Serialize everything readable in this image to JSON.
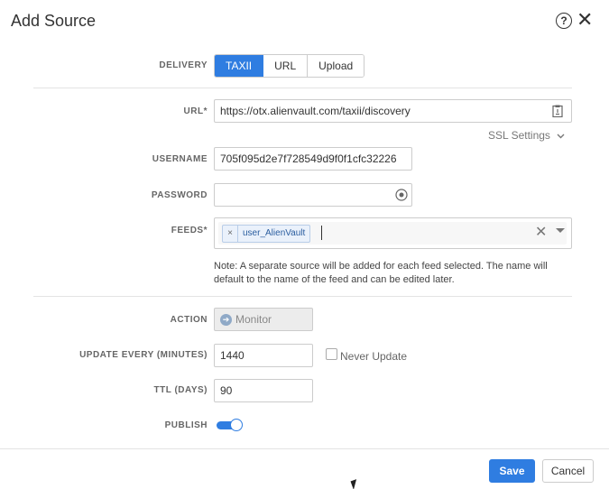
{
  "dialog": {
    "title": "Add Source",
    "help_glyph": "?",
    "close_glyph": "✕"
  },
  "delivery": {
    "label": "DELIVERY",
    "options": [
      "TAXII",
      "URL",
      "Upload"
    ],
    "selected": "TAXII"
  },
  "url": {
    "label": "URL*",
    "value": "https://otx.alienvault.com/taxii/discovery",
    "icon": "clipboard-icon"
  },
  "ssl_settings": {
    "label": "SSL Settings",
    "icon": "chevron-down-icon"
  },
  "username": {
    "label": "USERNAME",
    "value": "705f095d2e7f728549d9f0f1cfc32226"
  },
  "password": {
    "label": "PASSWORD",
    "value": "",
    "icon": "eye-icon"
  },
  "feeds": {
    "label": "FEEDS*",
    "chips": [
      {
        "label": "user_AlienVault",
        "remove_glyph": "×"
      }
    ],
    "clear_glyph": "✕"
  },
  "note": "Note: A separate source will be added for each feed selected. The name will default to the name of the feed and can be edited later.",
  "action": {
    "label": "ACTION",
    "value": "Monitor",
    "icon": "arrow-right-circle-icon"
  },
  "update_every": {
    "label": "UPDATE EVERY (MINUTES)",
    "value": "1440",
    "never_update_label": "Never Update",
    "never_update_checked": false
  },
  "ttl": {
    "label": "TTL (DAYS)",
    "value": "90"
  },
  "publish": {
    "label": "PUBLISH",
    "enabled": true
  },
  "footer": {
    "save_label": "Save",
    "cancel_label": "Cancel"
  },
  "colors": {
    "accent": "#2f7de1"
  }
}
